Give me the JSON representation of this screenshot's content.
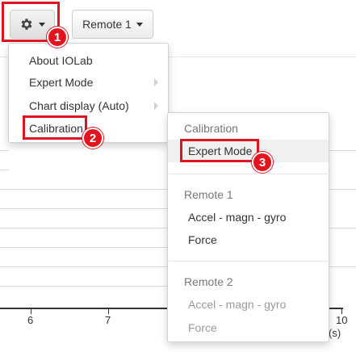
{
  "toolbar": {
    "settings_icon": "gear-icon",
    "remote_label": "Remote 1"
  },
  "main_menu": {
    "items": [
      {
        "label": "About IOLab",
        "has_submenu": false
      },
      {
        "label": "Expert Mode",
        "has_submenu": true
      },
      {
        "label": "Chart display (Auto)",
        "has_submenu": true
      },
      {
        "label": "Calibration",
        "has_submenu": false
      }
    ]
  },
  "calibration_menu": {
    "header": "Calibration",
    "expert_mode": "Expert Mode",
    "remote1_header": "Remote 1",
    "remote1_items": [
      "Accel - magn - gyro",
      "Force"
    ],
    "remote2_header": "Remote 2",
    "remote2_items": [
      "Accel - magn - gyro",
      "Force"
    ]
  },
  "annotations": {
    "step1": "1",
    "step2": "2",
    "step3": "3",
    "highlight_color": "#e0141e"
  },
  "chart": {
    "x_ticks": [
      "6",
      "7",
      "10"
    ],
    "x_unit": "(s)"
  }
}
